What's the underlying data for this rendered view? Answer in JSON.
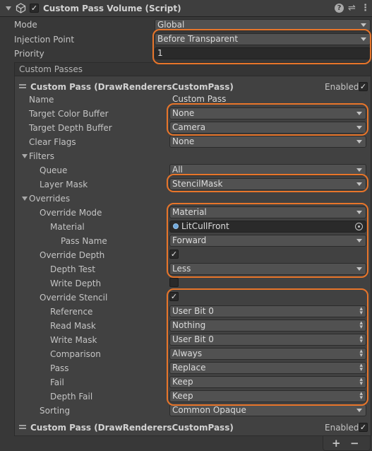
{
  "header": {
    "title": "Custom Pass Volume (Script)",
    "enabled": true
  },
  "component": {
    "mode_label": "Mode",
    "mode_value": "Global",
    "injection_label": "Injection Point",
    "injection_value": "Before Transparent",
    "priority_label": "Priority",
    "priority_value": "1"
  },
  "custom_passes": {
    "section_title": "Custom Passes",
    "pass1": {
      "title": "Custom Pass (DrawRenderersCustomPass)",
      "enabled_label": "Enabled",
      "enabled": true,
      "name_label": "Name",
      "name_value": "Custom Pass",
      "target_color_label": "Target Color Buffer",
      "target_color_value": "None",
      "target_depth_label": "Target Depth Buffer",
      "target_depth_value": "Camera",
      "clear_flags_label": "Clear Flags",
      "clear_flags_value": "None",
      "filters_label": "Filters",
      "queue_label": "Queue",
      "queue_value": "All",
      "layer_mask_label": "Layer Mask",
      "layer_mask_value": "StencilMask",
      "overrides_label": "Overrides",
      "override_mode_label": "Override Mode",
      "override_mode_value": "Material",
      "material_label": "Material",
      "material_value": "LitCullFront",
      "pass_name_label": "Pass Name",
      "pass_name_value": "Forward",
      "override_depth_label": "Override Depth",
      "override_depth_checked": true,
      "depth_test_label": "Depth Test",
      "depth_test_value": "Less",
      "write_depth_label": "Write Depth",
      "write_depth_checked": false,
      "override_stencil_label": "Override Stencil",
      "override_stencil_checked": true,
      "reference_label": "Reference",
      "reference_value": "User Bit 0",
      "read_mask_label": "Read Mask",
      "read_mask_value": "Nothing",
      "write_mask_label": "Write Mask",
      "write_mask_value": "User Bit 0",
      "comparison_label": "Comparison",
      "comparison_value": "Always",
      "pass_label": "Pass",
      "pass_value": "Replace",
      "fail_label": "Fail",
      "fail_value": "Keep",
      "depth_fail_label": "Depth Fail",
      "depth_fail_value": "Keep",
      "sorting_label": "Sorting",
      "sorting_value": "Common Opaque"
    },
    "pass2": {
      "title": "Custom Pass (DrawRenderersCustomPass)",
      "enabled_label": "Enabled",
      "enabled": true
    },
    "add_label": "+",
    "remove_label": "−"
  },
  "icons": {
    "help": "?",
    "preset": "⇌",
    "menu": "⋮",
    "check": "✓"
  },
  "colors": {
    "highlight": "#e8752a",
    "background": "#383838"
  }
}
